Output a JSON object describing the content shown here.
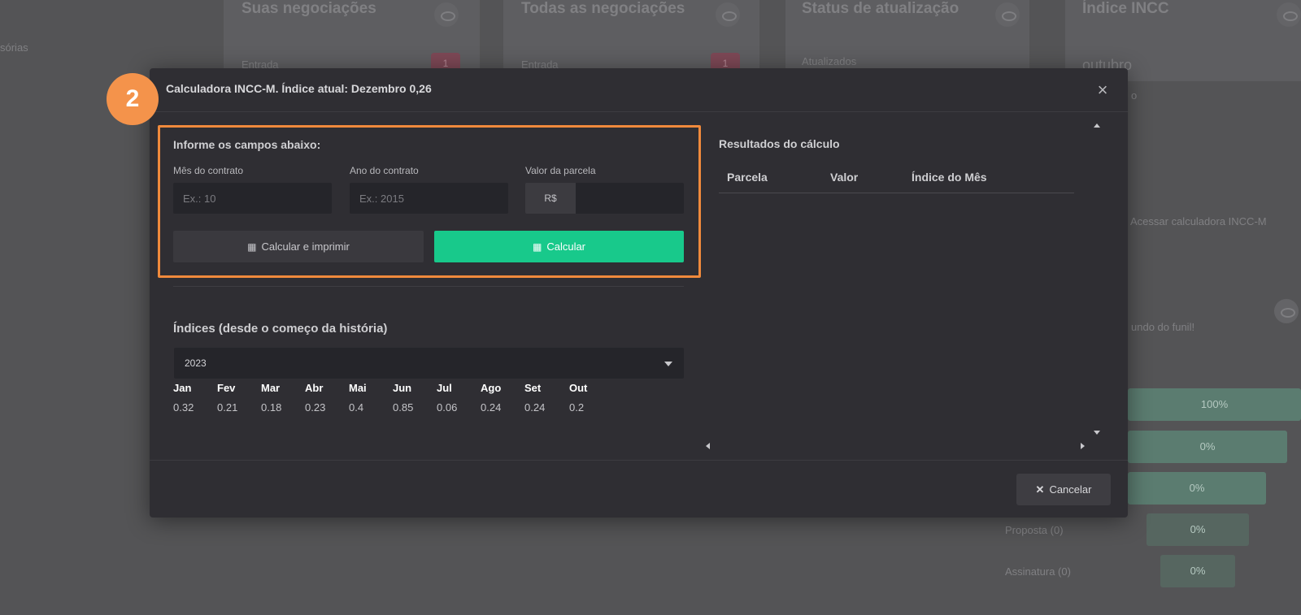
{
  "background": {
    "sidebar_fragment": "sórias",
    "cards": [
      {
        "title": "Suas negociações",
        "row_label": "Entrada",
        "badge": "1"
      },
      {
        "title": "Todas as negociações",
        "row_label": "Entrada",
        "badge": "1"
      },
      {
        "title": "Status de atualização",
        "row_label": "Atualizados"
      },
      {
        "title": "Índice INCC",
        "month": "outubro",
        "fragment": "o"
      }
    ],
    "access_calculator": "Acessar calculadora INCC-M",
    "funnel_text": "undo do funil!",
    "funnel": [
      {
        "label": "",
        "value": "100%",
        "fraction": 1.0
      },
      {
        "label": "",
        "value": "0%",
        "fraction": 0.0
      },
      {
        "label": "",
        "value": "0%",
        "fraction": 0.0
      },
      {
        "label": "Proposta (0)",
        "value": "0%",
        "fraction": 0.0
      },
      {
        "label": "Assinatura (0)",
        "value": "0%",
        "fraction": 0.0
      }
    ]
  },
  "step_number": "2",
  "modal": {
    "title": "Calculadora INCC-M. Índice atual: Dezembro 0,26",
    "close_icon": "close-icon",
    "form": {
      "heading": "Informe os campos abaixo:",
      "fields": [
        {
          "label": "Mês do contrato",
          "placeholder": "Ex.: 10",
          "value": ""
        },
        {
          "label": "Ano do contrato",
          "placeholder": "Ex.: 2015",
          "value": ""
        },
        {
          "label": "Valor da parcela",
          "prefix": "R$",
          "placeholder": "",
          "value": ""
        }
      ],
      "print_button": "Calcular e imprimir",
      "calc_button": "Calcular",
      "button_icon": "calculator-icon"
    },
    "indices": {
      "heading": "Índices (desde o começo da história)",
      "selected_year": "2023",
      "months": [
        {
          "name": "Jan",
          "value": "0.32"
        },
        {
          "name": "Fev",
          "value": "0.21"
        },
        {
          "name": "Mar",
          "value": "0.18"
        },
        {
          "name": "Abr",
          "value": "0.23"
        },
        {
          "name": "Mai",
          "value": "0.4"
        },
        {
          "name": "Jun",
          "value": "0.85"
        },
        {
          "name": "Jul",
          "value": "0.06"
        },
        {
          "name": "Ago",
          "value": "0.24"
        },
        {
          "name": "Set",
          "value": "0.24"
        },
        {
          "name": "Out",
          "value": "0.2"
        }
      ]
    },
    "results": {
      "heading": "Resultados do cálculo",
      "columns": [
        "Parcela",
        "Valor",
        "Índice do Mês"
      ]
    },
    "cancel_button": "Cancelar"
  },
  "colors": {
    "accent_green": "#18c98b",
    "highlight_orange": "#f08a3c",
    "step_badge": "#f4934b"
  }
}
